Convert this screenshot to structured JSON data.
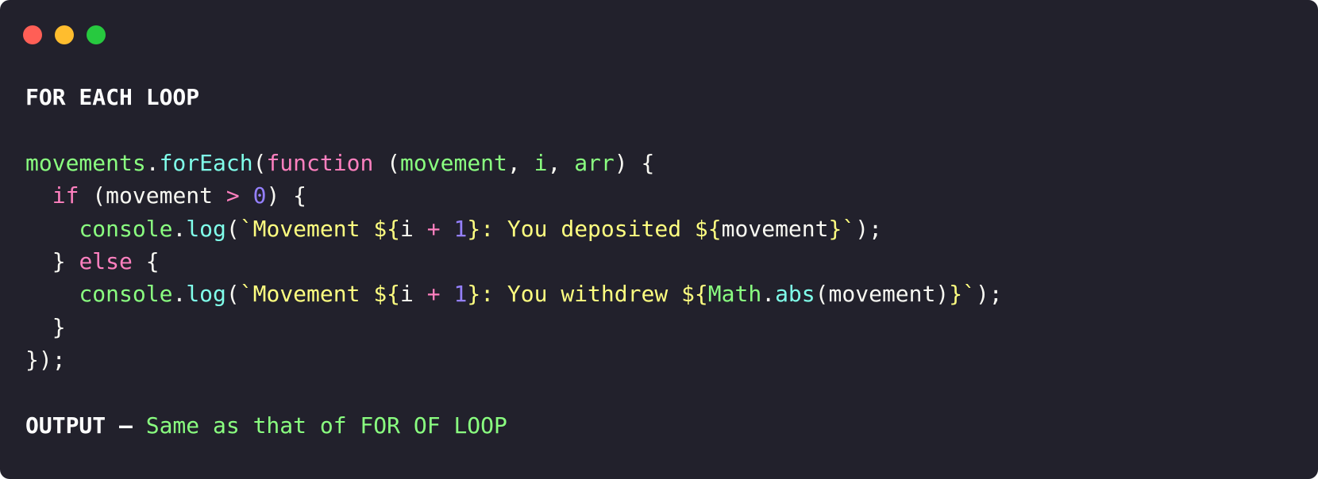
{
  "window": {
    "traffic_lights": [
      "close",
      "minimize",
      "maximize"
    ]
  },
  "colors": {
    "background": "#22212c",
    "variable": "#8aff80",
    "function": "#80ffea",
    "keyword": "#ff80bf",
    "number": "#9580ff",
    "string": "#ffff80",
    "text": "#f8f8f2"
  },
  "heading": "FOR EACH LOOP",
  "code": {
    "l1": {
      "movements": "movements",
      "dot": ".",
      "forEach": "forEach",
      "paren_open": "(",
      "function": "function",
      "space_paren": " (",
      "movement": "movement",
      "comma1": ", ",
      "i": "i",
      "comma2": ", ",
      "arr": "arr",
      "close": ") {"
    },
    "l2": {
      "indent": "  ",
      "if": "if",
      "open": " (movement ",
      "gt": ">",
      "space": " ",
      "zero": "0",
      "close": ") {"
    },
    "l3": {
      "indent": "    ",
      "console": "console",
      "dot": ".",
      "log": "log",
      "paren": "(",
      "str1": "`Movement ${",
      "i": "i ",
      "plus": "+",
      "space": " ",
      "one": "1",
      "str2": "}: You deposited ${",
      "movement": "movement",
      "str3": "}`",
      "end": ");"
    },
    "l4": {
      "indent": "  } ",
      "else": "else",
      "end": " {"
    },
    "l5": {
      "indent": "    ",
      "console": "console",
      "dot": ".",
      "log": "log",
      "paren": "(",
      "str1": "`Movement ${",
      "i": "i ",
      "plus": "+",
      "space": " ",
      "one": "1",
      "str2": "}: You withdrew ${",
      "math": "Math",
      "dot2": ".",
      "abs": "abs",
      "args": "(movement)",
      "str3": "}`",
      "end": ");"
    },
    "l6": "  }",
    "l7": "});"
  },
  "output": {
    "label": "OUTPUT –",
    "text": " Same as that of FOR OF LOOP"
  }
}
